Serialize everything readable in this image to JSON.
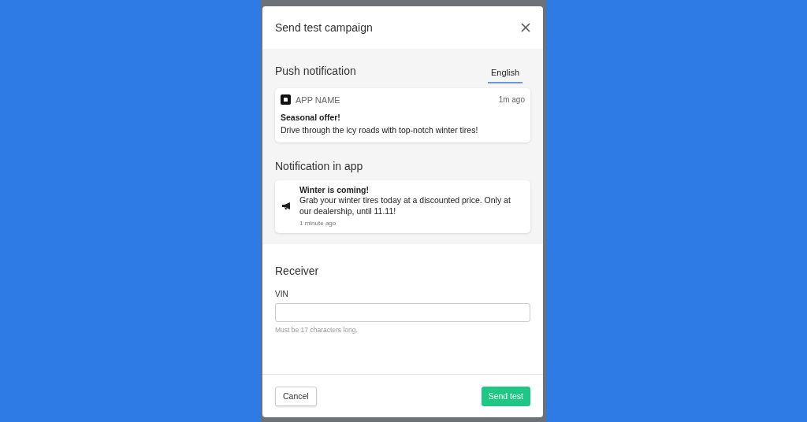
{
  "dialog": {
    "title": "Send test campaign"
  },
  "push_notification": {
    "heading": "Push notification",
    "tabs": [
      {
        "label": "English",
        "selected": true
      }
    ],
    "card": {
      "app_name": "APP NAME",
      "time": "1m ago",
      "title": "Seasonal offer!",
      "body": "Drive through the icy roads with top-notch winter tires!"
    }
  },
  "in_app": {
    "heading": "Notification in app",
    "card": {
      "title": "Winter is coming!",
      "body": "Grab your winter tires today at a discounted price. Only at our dealership, until 11.11!",
      "time": "1 minute ago"
    }
  },
  "receiver": {
    "heading": "Receiver",
    "field": {
      "label": "VIN",
      "hint": "Must be 17 characters long."
    }
  },
  "buttons": [
    {
      "label": "Cancel",
      "kind": "secondary"
    },
    {
      "label": "Send test",
      "kind": "primary"
    }
  ]
}
